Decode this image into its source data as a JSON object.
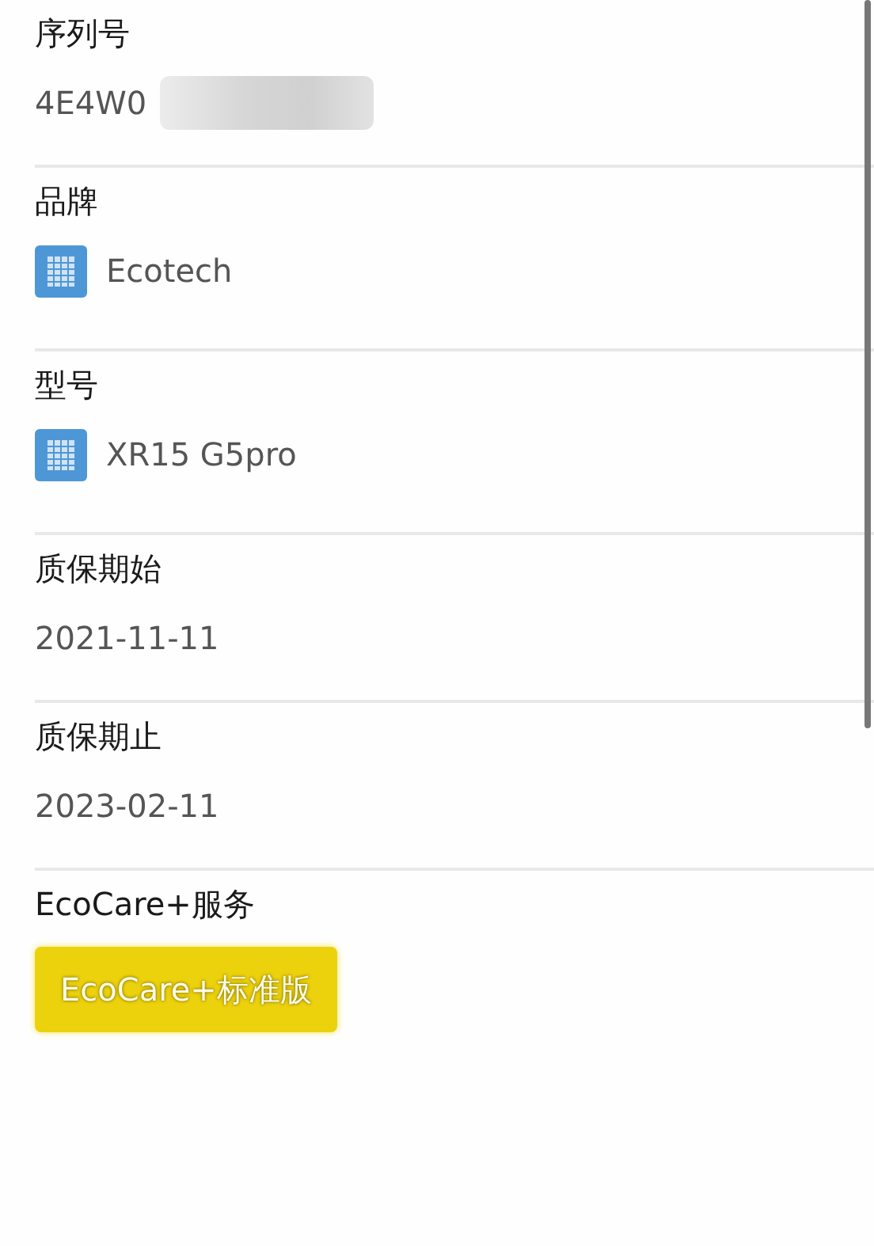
{
  "fields": [
    {
      "label": "序列号",
      "kind": "text",
      "value": "4E4W0",
      "redacted": true
    },
    {
      "label": "品牌",
      "kind": "tag",
      "value": "Ecotech"
    },
    {
      "label": "型号",
      "kind": "tag",
      "value": "XR15 G5pro"
    },
    {
      "label": "质保期始",
      "kind": "text",
      "value": "2021-11-11"
    },
    {
      "label": "质保期止",
      "kind": "text",
      "value": "2023-02-11"
    },
    {
      "label": "EcoCare+服务",
      "kind": "badge",
      "value": "EcoCare+标准版"
    }
  ]
}
